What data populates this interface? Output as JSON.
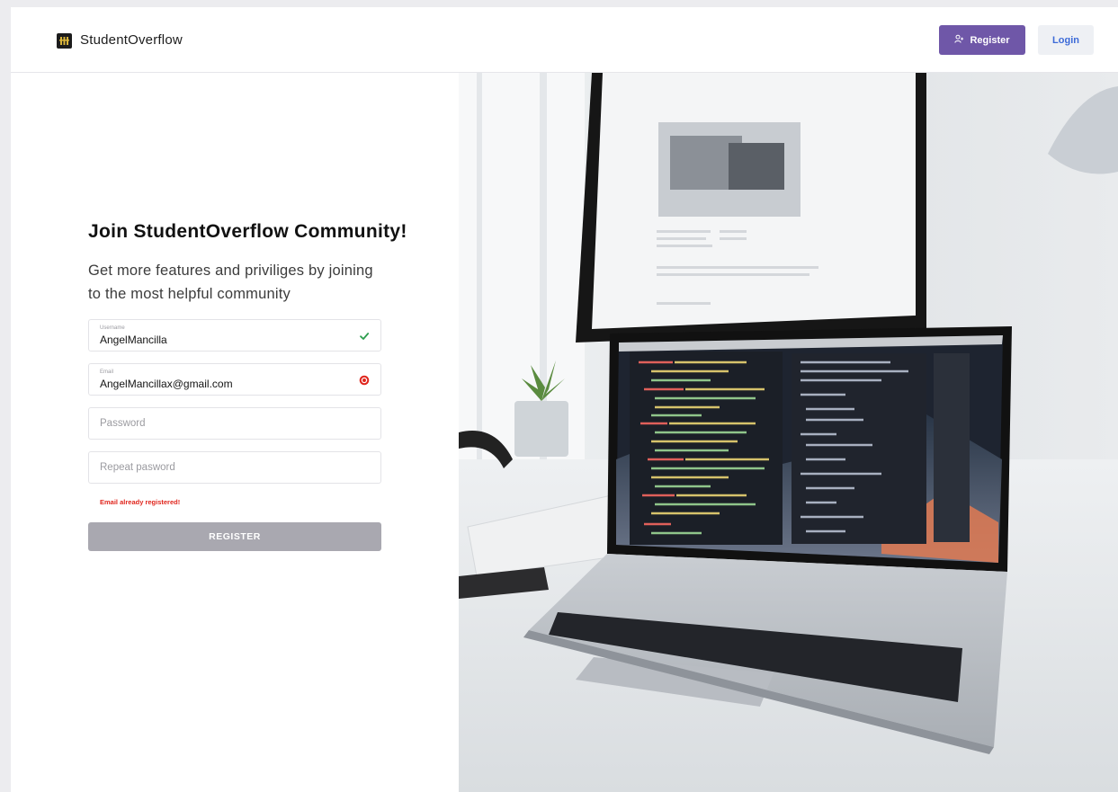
{
  "header": {
    "brand": "StudentOverflow",
    "register_label": "Register",
    "login_label": "Login"
  },
  "form": {
    "title": "Join StudentOverflow Community!",
    "subtitle": "Get more features and priviliges by joining to the most helpful community",
    "username": {
      "label": "Username",
      "value": "AngelMancilla",
      "status": "valid"
    },
    "email": {
      "label": "Email",
      "value": "AngelMancillax@gmail.com",
      "status": "error"
    },
    "password": {
      "placeholder": "Password"
    },
    "repeat_password": {
      "placeholder": "Repeat pasword"
    },
    "error_message": "Email already registered!",
    "submit_label": "REGISTER"
  },
  "colors": {
    "accent": "#6f57a8",
    "login_text": "#3d6bd8",
    "valid": "#2e9e4f",
    "error": "#e0261d",
    "submit_disabled": "#a9a8b0"
  },
  "icons": {
    "logo": "logo-icon",
    "register": "add-user-icon",
    "valid": "checkmark-icon",
    "error": "error-circle-icon"
  }
}
